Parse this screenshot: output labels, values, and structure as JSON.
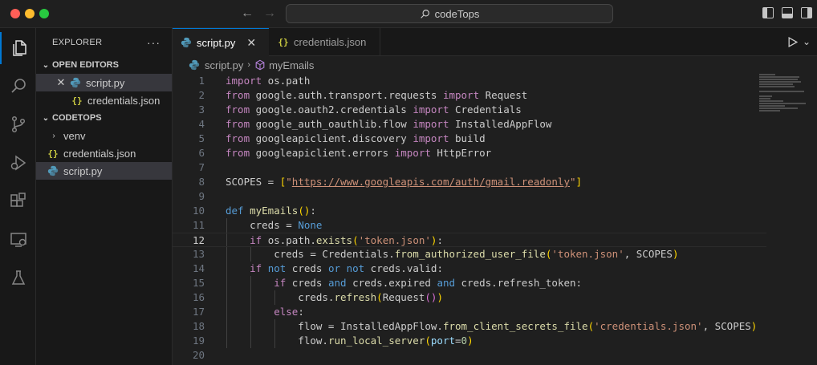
{
  "window": {
    "title": "codeTops"
  },
  "sidebar": {
    "header": "EXPLORER",
    "open_editors_label": "OPEN EDITORS",
    "open_editors": [
      {
        "name": "script.py",
        "type": "python",
        "active": true
      },
      {
        "name": "credentials.json",
        "type": "json",
        "active": false
      }
    ],
    "workspace_label": "CODETOPS",
    "workspace_items": [
      {
        "name": "venv",
        "type": "folder"
      },
      {
        "name": "credentials.json",
        "type": "json"
      },
      {
        "name": "script.py",
        "type": "python"
      }
    ]
  },
  "tabs": [
    {
      "label": "script.py",
      "icon": "python-file-icon",
      "active": true
    },
    {
      "label": "credentials.json",
      "icon": "json-file-icon",
      "active": false
    }
  ],
  "breadcrumb": {
    "file": "script.py",
    "symbol": "myEmails"
  },
  "editor": {
    "current_line": 12,
    "lines": [
      "import os.path",
      "from google.auth.transport.requests import Request",
      "from google.oauth2.credentials import Credentials",
      "from google_auth_oauthlib.flow import InstalledAppFlow",
      "from googleapiclient.discovery import build",
      "from googleapiclient.errors import HttpError",
      "",
      "SCOPES = [\"https://www.googleapis.com/auth/gmail.readonly\"]",
      "",
      "def myEmails():",
      "    creds = None",
      "    if os.path.exists('token.json'):",
      "        creds = Credentials.from_authorized_user_file('token.json', SCOPES)",
      "    if not creds or not creds.valid:",
      "        if creds and creds.expired and creds.refresh_token:",
      "            creds.refresh(Request())",
      "        else:",
      "            flow = InstalledAppFlow.from_client_secrets_file('credentials.json', SCOPES)",
      "            flow.run_local_server(port=0)",
      ""
    ]
  },
  "colors": {
    "accent": "#0078d4",
    "keyword": "#c586c0",
    "string": "#ce9178",
    "function": "#dcdcaa",
    "variable": "#9cdcfe"
  }
}
